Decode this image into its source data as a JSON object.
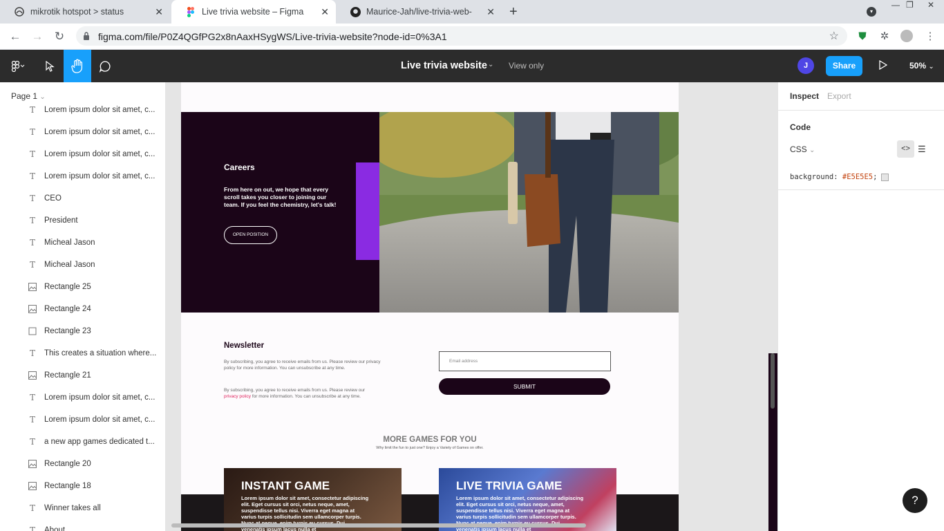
{
  "browser": {
    "tabs": [
      {
        "title": "mikrotik hotspot > status"
      },
      {
        "title": "Live trivia website – Figma"
      },
      {
        "title": "Maurice-Jah/live-trivia-web-"
      }
    ],
    "url": "figma.com/file/P0Z4QGfPG2x8nAaxHSygWS/Live-trivia-website?node-id=0%3A1"
  },
  "figma": {
    "file_title": "Live trivia website",
    "view_mode": "View only",
    "avatar_initial": "J",
    "share_label": "Share",
    "zoom": "50%"
  },
  "layers": {
    "page": "Page 1",
    "items": [
      {
        "type": "text",
        "name": "Lorem ipsum dolor sit amet, c..."
      },
      {
        "type": "text",
        "name": "Lorem ipsum dolor sit amet, c..."
      },
      {
        "type": "text",
        "name": "Lorem ipsum dolor sit amet, c..."
      },
      {
        "type": "text",
        "name": "Lorem ipsum dolor sit amet, c..."
      },
      {
        "type": "text",
        "name": "CEO"
      },
      {
        "type": "text",
        "name": "President"
      },
      {
        "type": "text",
        "name": "Micheal Jason"
      },
      {
        "type": "text",
        "name": "Micheal Jason"
      },
      {
        "type": "image",
        "name": "Rectangle 25"
      },
      {
        "type": "image",
        "name": "Rectangle 24"
      },
      {
        "type": "rect",
        "name": "Rectangle 23"
      },
      {
        "type": "text",
        "name": "This creates a situation where..."
      },
      {
        "type": "image",
        "name": "Rectangle 21"
      },
      {
        "type": "text",
        "name": "Lorem ipsum dolor sit amet, c..."
      },
      {
        "type": "text",
        "name": "Lorem ipsum dolor sit amet, c..."
      },
      {
        "type": "text",
        "name": "a new app games dedicated t..."
      },
      {
        "type": "image",
        "name": "Rectangle 20"
      },
      {
        "type": "image",
        "name": "Rectangle 18"
      },
      {
        "type": "text",
        "name": "Winner takes all"
      },
      {
        "type": "text",
        "name": "About"
      }
    ]
  },
  "canvas": {
    "careers": {
      "title": "Careers",
      "body": "From here on out, we hope that every scroll takes you closer to joining our team. If you feel the chemistry, let's talk!",
      "button": "OPEN POSITION"
    },
    "newsletter": {
      "title": "Newsletter",
      "para1": "By subscribing, you agree to receive emails from us. Please review our privacy policy for more information. You can unsubscribe at any time.",
      "para2_before": "By subscribing, you agree to receive emails from us. Please review our ",
      "para2_link": "privacy policy",
      "para2_after": " for more information. You can unsubscribe at any time.",
      "email_placeholder": "Email address",
      "submit": "SUBMIT"
    },
    "more_games": {
      "title": "MORE GAMES FOR YOU",
      "subtitle": "Why limit the fun to just one? Enjoy a Variety of Games on offer."
    },
    "cards": [
      {
        "title": "INSTANT GAME",
        "body": "Lorem ipsum dolor sit amet, consectetur adipiscing elit. Eget cursus sit orci, netus neque, amet, suspendisse tellus nisi. Viverra eget magna at varius turpis sollicitudin sem ullamcorper turpis. Nunc at neque, enim turpis eu cursus. Dui venenatis ipsum lacus nulla et"
      },
      {
        "title": "LIVE TRIVIA GAME",
        "body": "Lorem ipsum dolor sit amet, consectetur adipiscing elit. Eget cursus sit orci, netus neque, amet, suspendisse tellus nisi. Viverra eget magna at varius turpis sollicitudin sem ullamcorper turpis. Nunc at neque, enim turpis eu cursus. Dui venenatis ipsum lacus nulla et"
      }
    ]
  },
  "inspect": {
    "tab_inspect": "Inspect",
    "tab_export": "Export",
    "section": "Code",
    "language": "CSS",
    "property": "background:",
    "value": "#E5E5E5",
    "semicolon": ";"
  },
  "help": "?",
  "colors": {
    "figma_blue": "#18a0fb",
    "toolbar": "#2c2c2c",
    "brand_dark": "#1b0518",
    "accent_purple": "#8a2be2",
    "canvas_bg": "#e5e5e5"
  }
}
